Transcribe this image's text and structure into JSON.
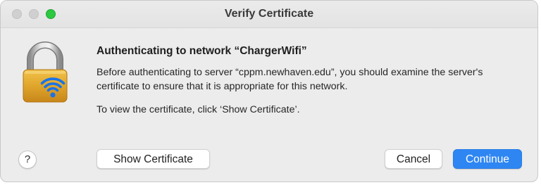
{
  "window": {
    "title": "Verify Certificate"
  },
  "dialog": {
    "heading": "Authenticating to network “ChargerWifi”",
    "message": "Before authenticating to server “cppm.newhaven.edu”, you should examine the server's certificate to ensure that it is appropriate for this network.",
    "instruction": "To view the certificate, click ‘Show Certificate’.",
    "icon": "lock-wifi-icon"
  },
  "buttons": {
    "help": "?",
    "show_certificate": "Show Certificate",
    "cancel": "Cancel",
    "continue": "Continue"
  },
  "colors": {
    "accent": "#2e86f3",
    "zoom_button": "#2bc840",
    "lock_gold": "#e0a62c"
  }
}
